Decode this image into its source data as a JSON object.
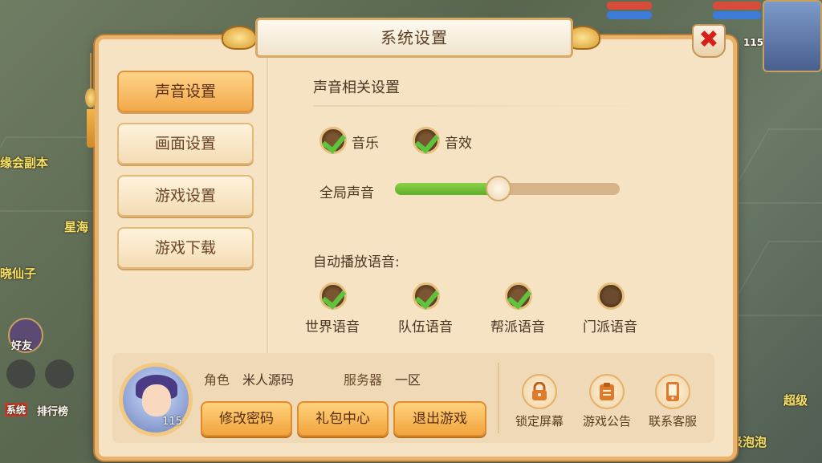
{
  "background": {
    "labels": [
      "缘会副本",
      "星海",
      "晓仙子",
      "好友",
      "系统",
      "排行榜",
      "超级",
      "级泡泡"
    ],
    "hud_level": "115"
  },
  "dialog": {
    "title": "系统设置",
    "close_icon": "close-x-icon"
  },
  "sidebar": {
    "items": [
      {
        "label": "声音设置",
        "active": true
      },
      {
        "label": "画面设置",
        "active": false
      },
      {
        "label": "游戏设置",
        "active": false
      },
      {
        "label": "游戏下载",
        "active": false
      }
    ]
  },
  "sound": {
    "section_title": "声音相关设置",
    "music_label": "音乐",
    "music_checked": true,
    "sfx_label": "音效",
    "sfx_checked": true,
    "volume_label": "全局声音",
    "volume_level": 0.46,
    "auto_voice_title": "自动播放语音:",
    "channels": [
      {
        "label": "世界语音",
        "checked": true
      },
      {
        "label": "队伍语音",
        "checked": true
      },
      {
        "label": "帮派语音",
        "checked": true
      },
      {
        "label": "门派语音",
        "checked": false
      }
    ]
  },
  "player": {
    "role_label": "角色",
    "role_value": "米人源码",
    "server_label": "服务器",
    "server_value": "一区",
    "level": "115",
    "buttons": {
      "change_password": "修改密码",
      "gift_center": "礼包中心",
      "exit_game": "退出游戏"
    }
  },
  "shortcuts": [
    {
      "label": "锁定屏幕",
      "icon": "lock-icon"
    },
    {
      "label": "游戏公告",
      "icon": "notice-board-icon"
    },
    {
      "label": "联系客服",
      "icon": "phone-icon"
    }
  ],
  "colors": {
    "accent_gold": "#f2a43c",
    "check_green": "#5ec43d",
    "close_red": "#d6201c"
  }
}
